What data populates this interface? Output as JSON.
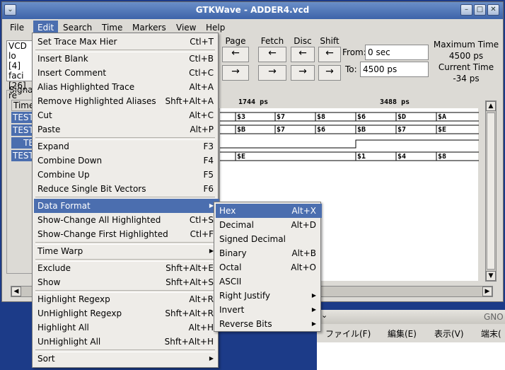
{
  "window": {
    "title": "GTKWave - ADDER4.vcd",
    "menubar": [
      "File",
      "Edit",
      "Search",
      "Time",
      "Markers",
      "View",
      "Help"
    ],
    "active_menu": "Edit"
  },
  "toolbar": {
    "groups": [
      {
        "label": "Page",
        "back": "←",
        "fwd": "→"
      },
      {
        "label": "Fetch",
        "back": "←",
        "fwd": "→"
      },
      {
        "label": "Disc",
        "back": "←",
        "fwd": "→"
      },
      {
        "label": "Shift",
        "back": "←",
        "fwd": "→"
      }
    ],
    "from_label": "From:",
    "from_value": "0 sec",
    "to_label": "To:",
    "to_value": "4500 ps",
    "max_time_label": "Maximum Time",
    "max_time_value": "4500 ps",
    "current_time_label": "Current Time",
    "current_time_value": "-34 ps"
  },
  "left_panel": {
    "lines": [
      "VCD lo",
      "[4] faci",
      "[26] re"
    ],
    "signals_label": "Signa",
    "time_label": "Time",
    "signal_rows": [
      "TEST",
      "TEST",
      "TE",
      "TEST"
    ]
  },
  "wave": {
    "ruler": [
      "1744 ps",
      "3488 ps"
    ],
    "rows": [
      [
        "$3",
        "$7",
        "$8",
        "$6",
        "$D",
        "$A"
      ],
      [
        "$B",
        "$7",
        "$6",
        "$B",
        "$7",
        "$E"
      ],
      [],
      [
        "$E",
        "$1",
        "$4",
        "$8"
      ]
    ]
  },
  "edit_menu": [
    {
      "label": "Set Trace Max Hier",
      "accel": "Ctl+T"
    },
    {
      "sep": true
    },
    {
      "label": "Insert Blank",
      "accel": "Ctl+B"
    },
    {
      "label": "Insert Comment",
      "accel": "Ctl+C"
    },
    {
      "label": "Alias Highlighted Trace",
      "accel": "Alt+A"
    },
    {
      "label": "Remove Highlighted Aliases",
      "accel": "Shft+Alt+A"
    },
    {
      "label": "Cut",
      "accel": "Alt+C"
    },
    {
      "label": "Paste",
      "accel": "Alt+P"
    },
    {
      "sep": true
    },
    {
      "label": "Expand",
      "accel": "F3"
    },
    {
      "label": "Combine Down",
      "accel": "F4"
    },
    {
      "label": "Combine Up",
      "accel": "F5"
    },
    {
      "label": "Reduce Single Bit Vectors",
      "accel": "F6"
    },
    {
      "sep": true
    },
    {
      "label": "Data Format",
      "accel": "▶",
      "highlight": true
    },
    {
      "label": "Show-Change All Highlighted",
      "accel": "Ctl+S"
    },
    {
      "label": "Show-Change First Highlighted",
      "accel": "Ctl+F"
    },
    {
      "sep": true
    },
    {
      "label": "Time Warp",
      "accel": "▶"
    },
    {
      "sep": true
    },
    {
      "label": "Exclude",
      "accel": "Shft+Alt+E"
    },
    {
      "label": "Show",
      "accel": "Shft+Alt+S"
    },
    {
      "sep": true
    },
    {
      "label": "Highlight Regexp",
      "accel": "Alt+R"
    },
    {
      "label": "UnHighlight Regexp",
      "accel": "Shft+Alt+R"
    },
    {
      "label": "Highlight All",
      "accel": "Alt+H"
    },
    {
      "label": "UnHighlight All",
      "accel": "Shft+Alt+H"
    },
    {
      "sep": true
    },
    {
      "label": "Sort",
      "accel": "▶"
    }
  ],
  "format_submenu": [
    {
      "label": "Hex",
      "accel": "Alt+X",
      "highlight": true
    },
    {
      "label": "Decimal",
      "accel": "Alt+D"
    },
    {
      "label": "Signed Decimal",
      "accel": ""
    },
    {
      "label": "Binary",
      "accel": "Alt+B"
    },
    {
      "label": "Octal",
      "accel": "Alt+O"
    },
    {
      "label": "ASCII",
      "accel": ""
    },
    {
      "label": "Right Justify",
      "accel": "▶"
    },
    {
      "label": "Invert",
      "accel": "▶"
    },
    {
      "label": "Reverse Bits",
      "accel": "▶"
    }
  ],
  "second_window": {
    "title": "GNO",
    "menus": [
      "ファイル(F)",
      "編集(E)",
      "表示(V)",
      "端末("
    ]
  },
  "colors": {
    "highlight": "#4b6eaf",
    "titlebar": "#3d63a9",
    "desktop": "#1c3b88"
  }
}
